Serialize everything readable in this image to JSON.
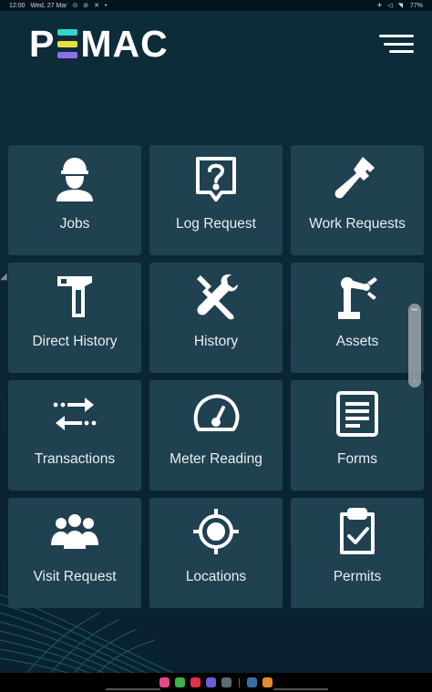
{
  "status_bar": {
    "time": "12:00",
    "date": "Wed, 27 Mar",
    "left_icons": "⊙ ⊘ ✕ •",
    "right_icons": "✈ ◁ ◥",
    "battery": "77%"
  },
  "header": {
    "logo_parts": [
      "P",
      "MAC"
    ],
    "logo_bar_colors": [
      "#2fd7d0",
      "#e6e03c",
      "#8f6fe6"
    ]
  },
  "tiles": [
    {
      "label": "Jobs",
      "icon": "worker-icon"
    },
    {
      "label": "Log Request",
      "icon": "question-bubble-icon"
    },
    {
      "label": "Work Requests",
      "icon": "pipe-wrench-icon"
    },
    {
      "label": "Direct History",
      "icon": "hammer-icon"
    },
    {
      "label": "History",
      "icon": "tools-icon"
    },
    {
      "label": "Assets",
      "icon": "robot-arm-icon"
    },
    {
      "label": "Transactions",
      "icon": "transfer-arrows-icon"
    },
    {
      "label": "Meter Reading",
      "icon": "gauge-icon"
    },
    {
      "label": "Forms",
      "icon": "document-icon"
    },
    {
      "label": "Visit Request",
      "icon": "group-icon"
    },
    {
      "label": "Locations",
      "icon": "crosshair-icon"
    },
    {
      "label": "Permits",
      "icon": "clipboard-check-icon"
    }
  ],
  "nav_apps": [
    "#e04a8b",
    "#3fb04a",
    "#e0334a",
    "#6a5fd6",
    "#5d6b78",
    "#3a6ea5",
    "#e8892c"
  ]
}
